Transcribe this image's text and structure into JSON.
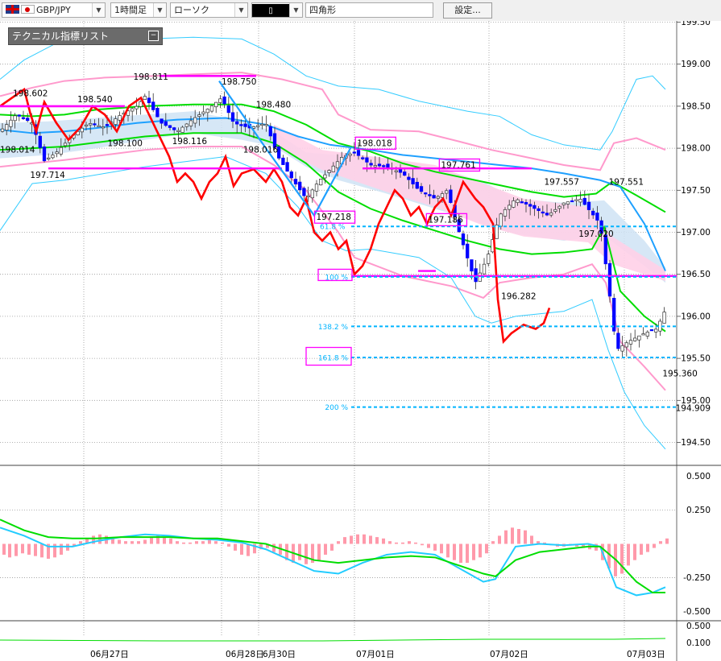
{
  "toolbar": {
    "symbol": "GBP/JPY",
    "timeframe": "1時間足",
    "chart_style": "ローソク",
    "drawing_tool": "四角形",
    "settings_button": "設定..."
  },
  "tech_list": {
    "label": "テクニカル指標リスト"
  },
  "colors": {
    "candle_up": "#ffffff",
    "candle_down": "#0000ff",
    "red_line": "#ff0000",
    "green_band": "#00dd00",
    "pink_band": "#ff99cc",
    "cyan_band": "#33ccff",
    "blue_line": "#1ea0ff",
    "magenta": "#ff00ff",
    "fib_line": "#00b4ff",
    "cloud": "#cfe3f5",
    "cloud_pink": "#ffd0e8"
  },
  "chart_data": {
    "type": "candlestick",
    "x_labels": [
      "06月27日",
      "06月28日",
      "6月30日",
      "07月01日",
      "07月02日",
      "07月03日"
    ],
    "y_ticks": [
      "199.50",
      "199.00",
      "198.50",
      "198.00",
      "197.50",
      "197.00",
      "196.50",
      "196.00",
      "195.50",
      "195.00",
      "194.50"
    ],
    "ylim": [
      194.3,
      199.6
    ],
    "current_price": "194.909",
    "price_labels": [
      {
        "text": "198.602",
        "x": 6,
        "y": 198.65
      },
      {
        "text": "198.014",
        "x": 0,
        "y": 197.98
      },
      {
        "text": "197.714",
        "x": 14,
        "y": 197.68
      },
      {
        "text": "198.540",
        "x": 36,
        "y": 198.58
      },
      {
        "text": "198.100",
        "x": 50,
        "y": 198.06
      },
      {
        "text": "198.811",
        "x": 62,
        "y": 198.85
      },
      {
        "text": "198.116",
        "x": 80,
        "y": 198.08
      },
      {
        "text": "198.750",
        "x": 103,
        "y": 198.79
      },
      {
        "text": "198.016",
        "x": 113,
        "y": 197.98
      },
      {
        "text": "198.480",
        "x": 119,
        "y": 198.52
      },
      {
        "text": "197.218",
        "x": 147,
        "y": 197.18
      },
      {
        "text": "198.018",
        "x": 166,
        "y": 198.06
      },
      {
        "text": "197.761",
        "x": 205,
        "y": 197.8
      },
      {
        "text": "197.186",
        "x": 199,
        "y": 197.15
      },
      {
        "text": "196.282",
        "x": 233,
        "y": 196.24
      },
      {
        "text": "197.557",
        "x": 253,
        "y": 197.6
      },
      {
        "text": "197.551",
        "x": 283,
        "y": 197.6
      },
      {
        "text": "197.020",
        "x": 269,
        "y": 196.98
      },
      {
        "text": "195.360",
        "x": 308,
        "y": 195.32
      }
    ],
    "fib_levels": [
      {
        "label": "61.8 %",
        "price": 197.07,
        "visible": false
      },
      {
        "label": "100 %",
        "price": 196.47
      },
      {
        "label": "138.2 %",
        "price": 195.88
      },
      {
        "label": "161.8 %",
        "price": 195.51
      },
      {
        "label": "200 %",
        "price": 194.92
      }
    ],
    "osc_ticks": [
      "0.500",
      "0.250",
      "-0.250",
      "-0.500"
    ],
    "osc_ylim": [
      -0.55,
      0.58
    ],
    "bottom_ticks": [
      "0.500",
      "0.100"
    ]
  }
}
